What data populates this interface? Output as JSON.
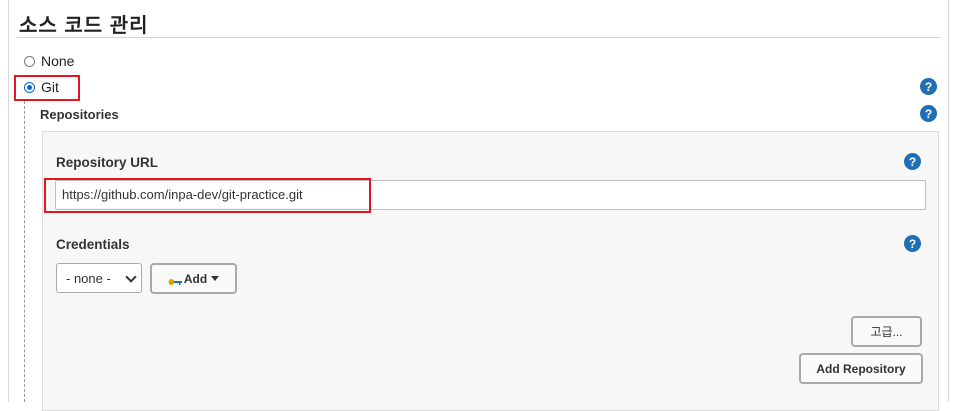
{
  "section": {
    "title": "소스 코드 관리"
  },
  "scm_options": [
    {
      "label": "None",
      "selected": false
    },
    {
      "label": "Git",
      "selected": true
    }
  ],
  "git": {
    "repositories_label": "Repositories",
    "repository_url": {
      "label": "Repository URL",
      "value": "https://github.com/inpa-dev/git-practice.git"
    },
    "credentials": {
      "label": "Credentials",
      "selected": "- none -",
      "add_button": "Add"
    },
    "advanced_button": "고급...",
    "add_repository_button": "Add Repository"
  },
  "help_icon_glyph": "?",
  "colors": {
    "highlight": "#e3171b",
    "help": "#1f6fb2",
    "radio_selected": "#0b67d0"
  }
}
